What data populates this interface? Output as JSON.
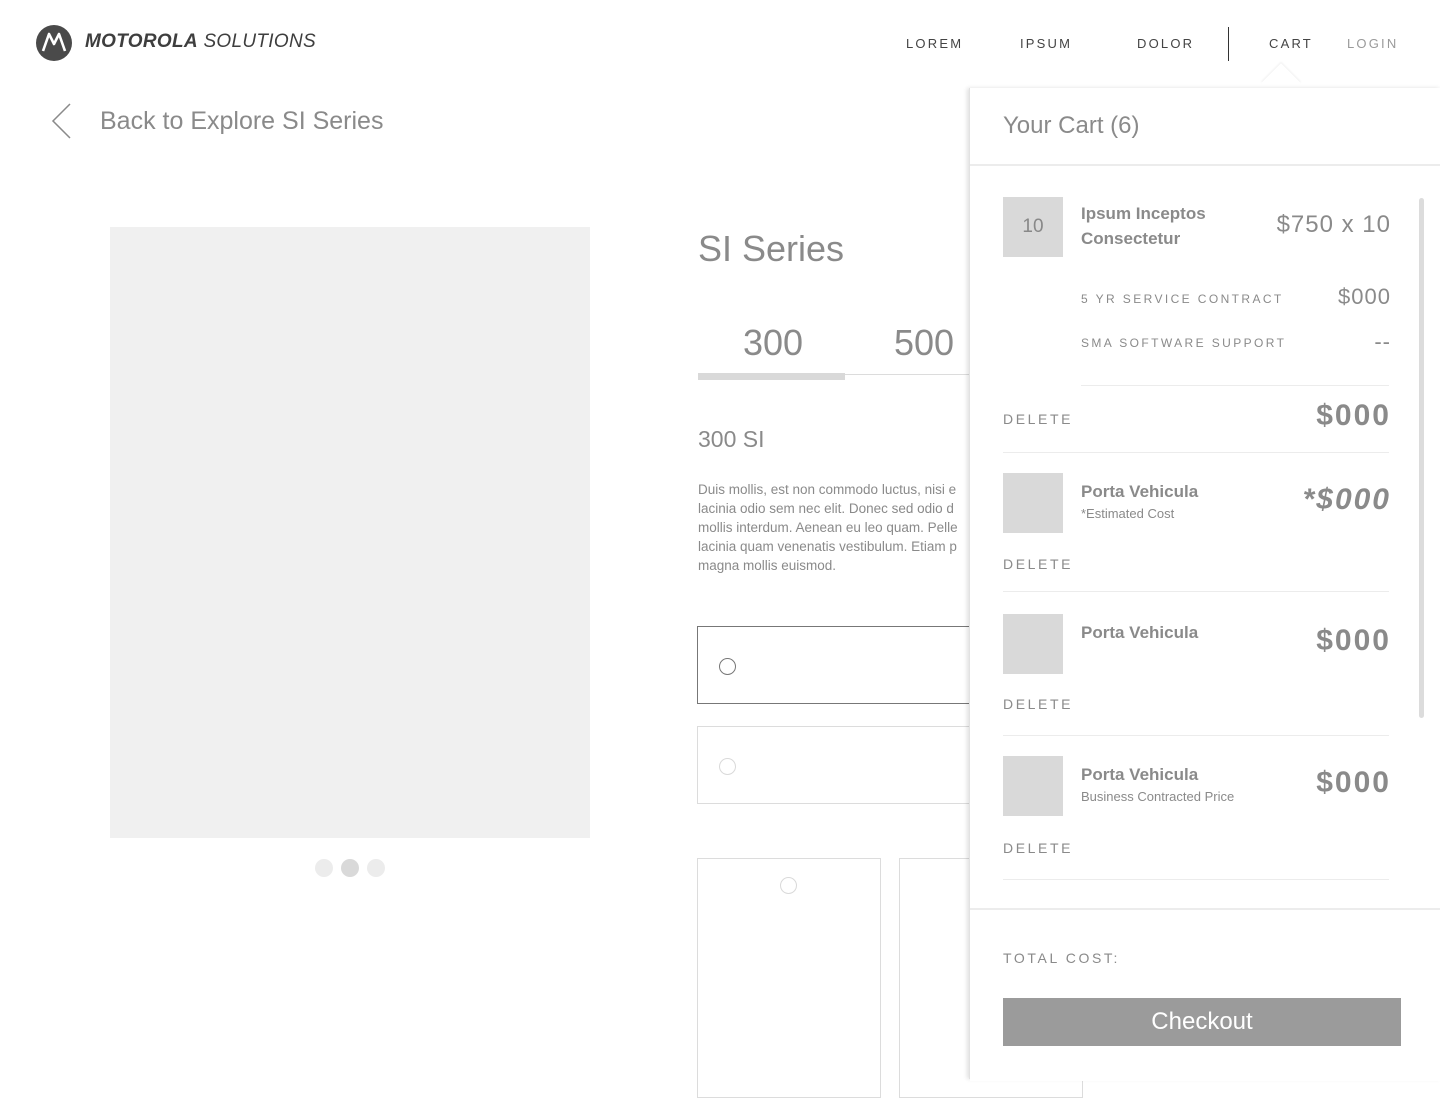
{
  "brand": {
    "name_bold": "MOTOROLA",
    "name_light": " SOLUTIONS",
    "logo_icon": "motorola-batwing-logo"
  },
  "nav": {
    "lorem": "LOREM",
    "ipsum": "IPSUM",
    "dolor": "DOLOR",
    "cart": "CART",
    "login": "LOGIN"
  },
  "back": {
    "label": "Back to Explore SI Series",
    "icon": "chevron-left-icon"
  },
  "gallery": {
    "slide_count": 3,
    "active_slide": 2
  },
  "product": {
    "title": "SI Series",
    "tabs": [
      {
        "label": "300",
        "active": true
      },
      {
        "label": "500",
        "active": false
      }
    ],
    "subtitle": "300 SI",
    "description": "Duis mollis, est non commodo luctus, nisi e\nlacinia odio sem nec elit. Donec sed odio d\nmollis interdum. Aenean eu leo quam. Pelle\nlacinia quam venenatis vestibulum. Etiam p\nmagna mollis euismod."
  },
  "cart": {
    "title": "Your Cart (6)",
    "items": [
      {
        "qty": "10",
        "name_line1": "Ipsum Inceptos",
        "name_line2": "Consectetur",
        "unit_price": "$750 x 10",
        "addons": [
          {
            "label": "5 YR SERVICE CONTRACT",
            "value": "$000"
          },
          {
            "label": "SMA SOFTWARE SUPPORT",
            "value": "--"
          }
        ],
        "delete_label": "DELETE",
        "total": "$000"
      },
      {
        "name": "Porta Vehicula",
        "note": "*Estimated Cost",
        "price": "*$000",
        "delete_label": "DELETE"
      },
      {
        "name": "Porta Vehicula",
        "price": "$000",
        "delete_label": "DELETE"
      },
      {
        "name": "Porta Vehicula",
        "note": "Business Contracted Price",
        "price": "$000",
        "delete_label": "DELETE"
      }
    ],
    "total_label": "TOTAL COST:",
    "checkout_label": "Checkout"
  }
}
